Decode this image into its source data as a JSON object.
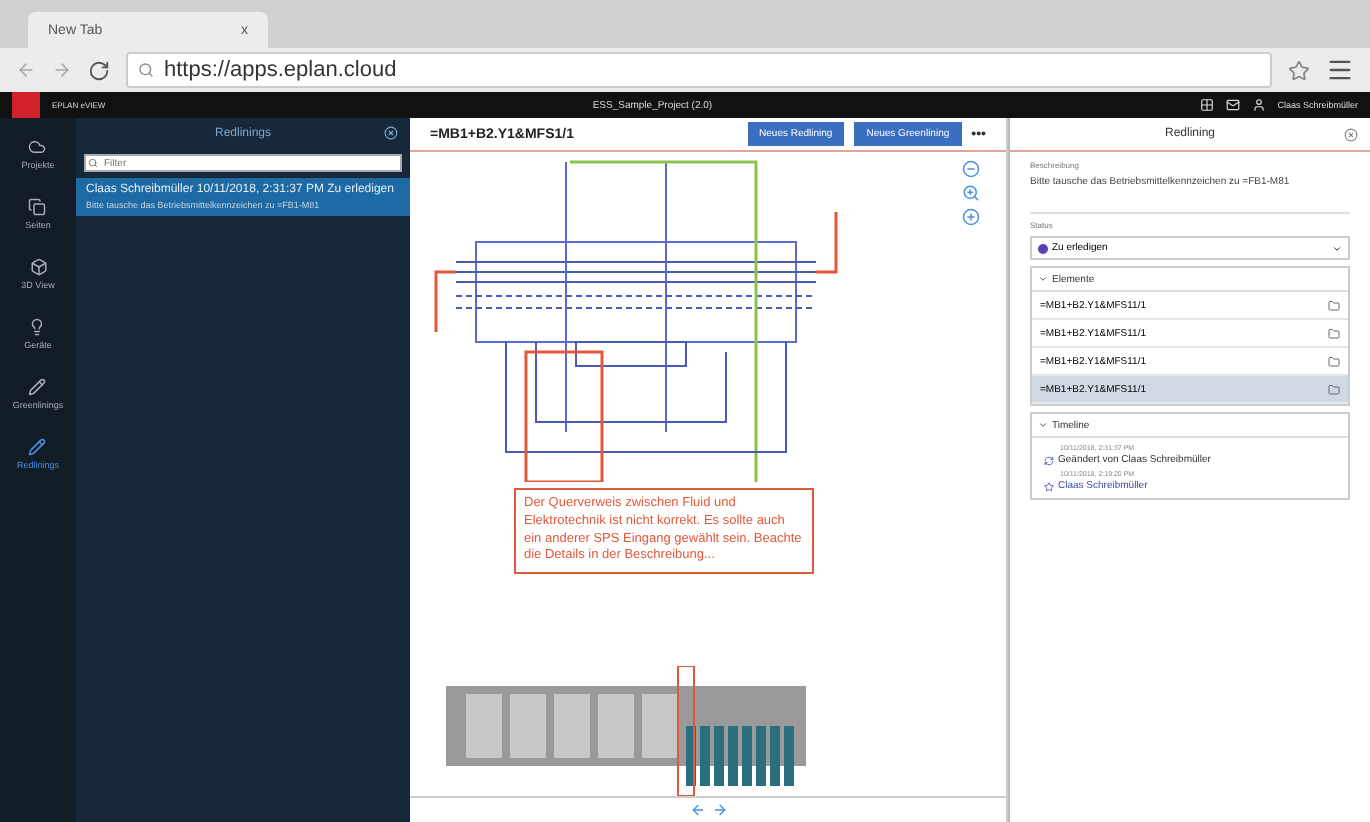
{
  "browser": {
    "tab": {
      "title": "New Tab",
      "close": "x"
    },
    "url": "https://apps.eplan.cloud"
  },
  "app_header": {
    "brand": "EPLAN eVIEW",
    "project": "ESS_Sample_Project (2.0)",
    "user": "Claas Schreibmüller"
  },
  "nav_rail": [
    {
      "label": "Projekte",
      "selected": false
    },
    {
      "label": "Seiten",
      "selected": false
    },
    {
      "label": "3D View",
      "selected": false
    },
    {
      "label": "Geräte",
      "selected": false
    },
    {
      "label": "Greenlinings",
      "selected": false
    },
    {
      "label": "Redlinings",
      "selected": true
    }
  ],
  "redlinings_panel": {
    "title": "Redlinings",
    "search": {
      "placeholder": "Filter"
    },
    "items": [
      {
        "title": "Claas Schreibmüller 10/11/2018, 2:31:37 PM  Zu erledigen",
        "subtitle": "Bitte tausche das Betriebsmittelkennzeichen zu =FB1-M81",
        "selected": true
      }
    ]
  },
  "canvas": {
    "page_title": "=MB1+B2.Y1&MFS1/1",
    "buttons": [
      "Neues Redlining",
      "Neues Greenlining"
    ],
    "more": "•••",
    "annotation": "Der Querverweis zwischen Fluid und Elektrotechnik ist nicht korrekt. Es sollte auch ein anderer SPS Eingang gewählt sein. Beachte die Details in der Beschreibung..."
  },
  "detail_panel": {
    "title": "Redlining",
    "description_label": "Beschreibung",
    "description": "Bitte tausche das Betriebsmittelkennzeichen zu =FB1-M81",
    "status_label": "Status",
    "status": {
      "value": "Zu erledigen",
      "color": "#5a3fb5"
    },
    "elements": {
      "title": "Elemente",
      "expanded": true,
      "items": [
        {
          "label": "=MB1+B2.Y1&MFS11/1",
          "selected": false
        },
        {
          "label": "=MB1+B2.Y1&MFS11/1",
          "selected": false
        },
        {
          "label": "=MB1+B2.Y1&MFS11/1",
          "selected": false
        },
        {
          "label": "=MB1+B2.Y1&MFS11/1",
          "selected": true
        }
      ]
    },
    "timeline": {
      "title": "Timeline",
      "expanded": true,
      "entries": [
        {
          "time": "10/11/2018, 2:31:37 PM",
          "text": "Geändert von Claas Schreibmüller",
          "kind": "changed"
        },
        {
          "time": "10/11/2018, 2:19:20 PM",
          "text": "Claas Schreibmüller",
          "kind": "created"
        }
      ]
    }
  }
}
